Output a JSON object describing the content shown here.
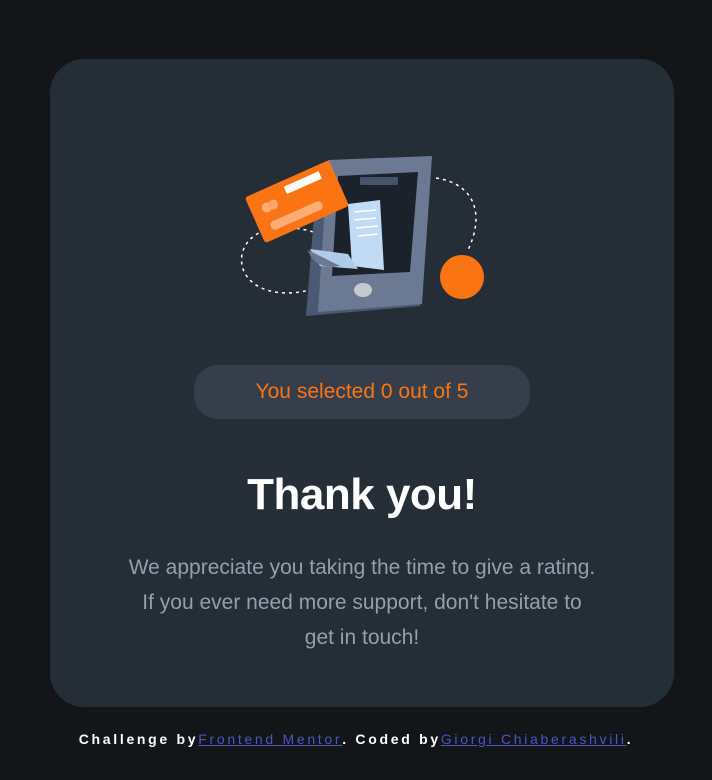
{
  "colors": {
    "page_bg": "#131518",
    "card_bg": "#252d37",
    "accent": "#fb7413",
    "badge_bg": "#363e4b",
    "heading": "#ffffff",
    "body_text": "#959eac",
    "link": "#4b55c2"
  },
  "illustration": {
    "icon": "phone-payment-illustration"
  },
  "rating": {
    "selected_text": "You selected 0 out of 5"
  },
  "thank_you": {
    "title": "Thank you!",
    "message": "We appreciate you taking the time to give a rating. If you ever need more support, don't hesitate to get in touch!"
  },
  "footer": {
    "challenge_prefix": "Challenge by",
    "challenge_link": "Frontend Mentor",
    "coded_prefix": ". Coded by",
    "author_link": "Giorgi Chiaberashvili",
    "suffix": "."
  }
}
